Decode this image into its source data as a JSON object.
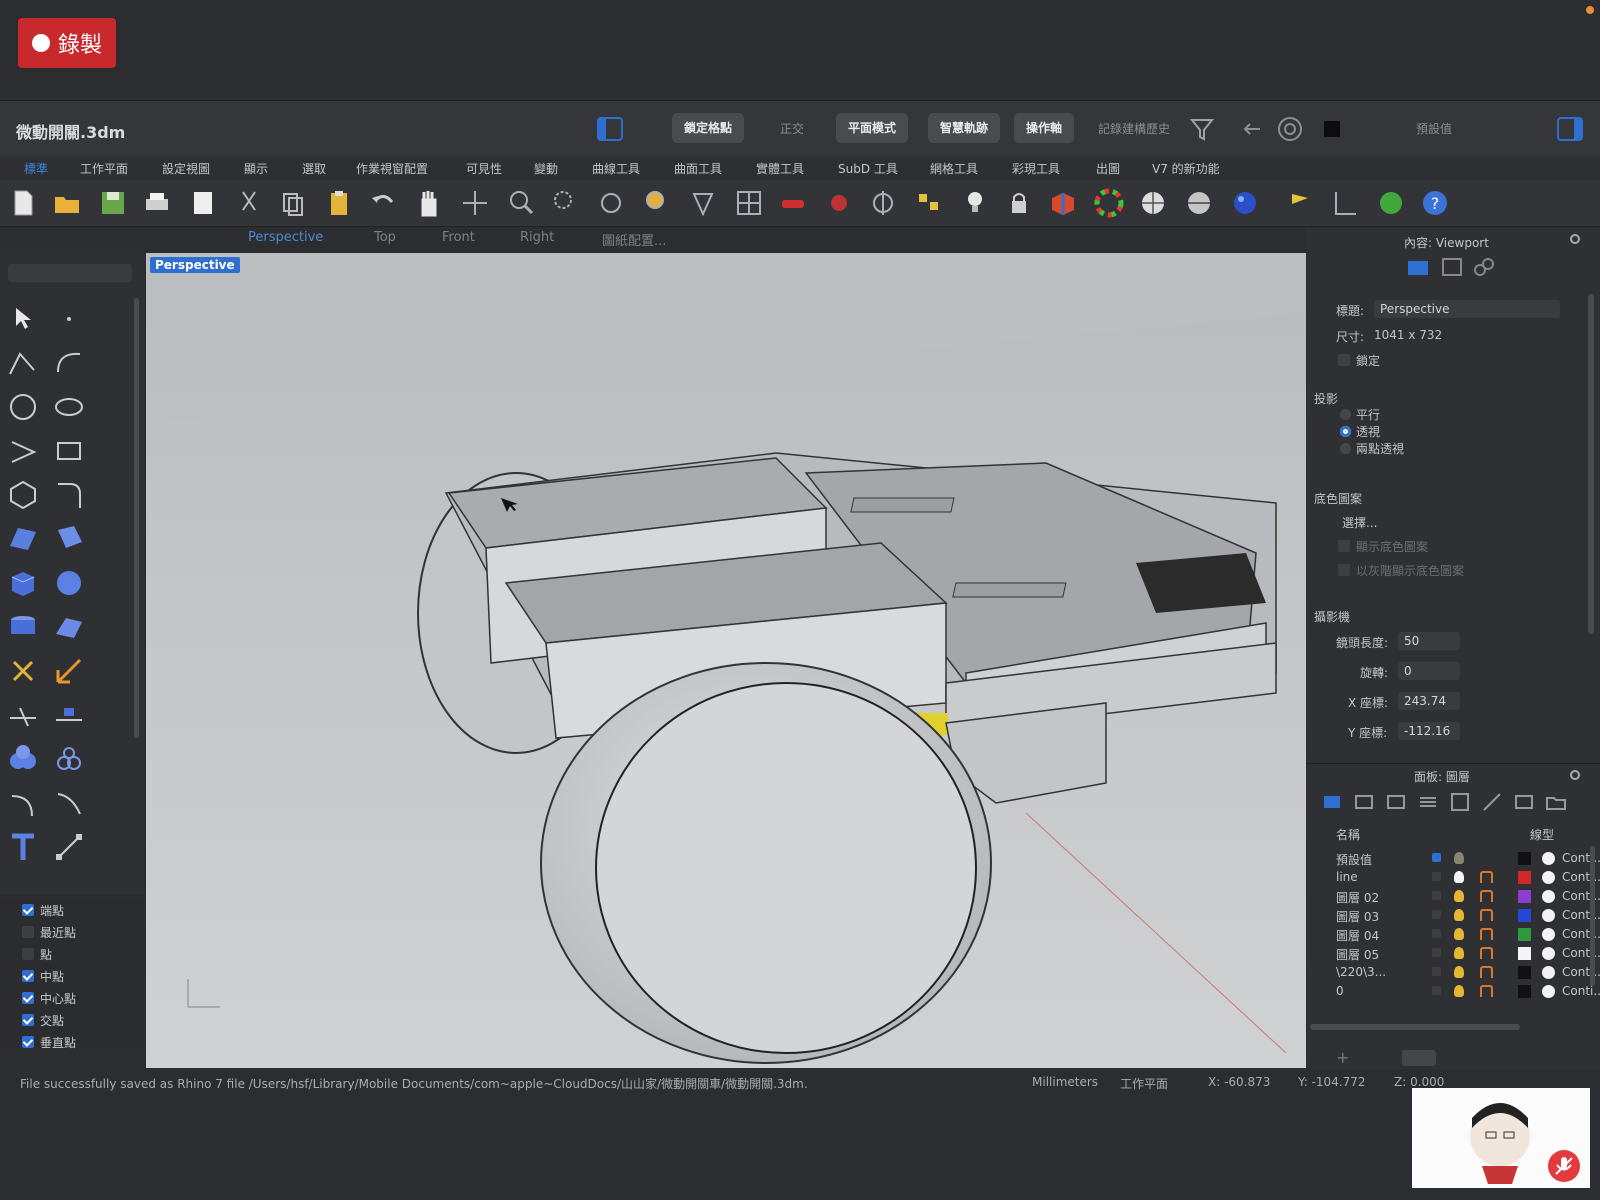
{
  "recording": {
    "label": "錄製"
  },
  "titlebar": {
    "doc_title": "微動開關.3dm",
    "buttons": [
      "鎖定格點",
      "正交",
      "平面模式",
      "智慧軌跡",
      "操作軸",
      "記錄建構歷史",
      "預設值"
    ]
  },
  "menu": {
    "tabs": [
      "標準",
      "工作平面",
      "設定視圖",
      "顯示",
      "選取",
      "作業視窗配置",
      "可見性",
      "變動",
      "曲線工具",
      "曲面工具",
      "實體工具",
      "SubD 工具",
      "網格工具",
      "彩現工具",
      "出圖",
      "V7 的新功能"
    ],
    "active_index": 0
  },
  "view_tabs": {
    "tabs": [
      "Perspective",
      "Top",
      "Front",
      "Right",
      "圖紙配置..."
    ],
    "active_index": 0
  },
  "viewport": {
    "label": "Perspective"
  },
  "osnap": {
    "items": [
      {
        "label": "端點",
        "checked": true
      },
      {
        "label": "最近點",
        "checked": false
      },
      {
        "label": "點",
        "checked": false
      },
      {
        "label": "中點",
        "checked": true
      },
      {
        "label": "中心點",
        "checked": true
      },
      {
        "label": "交點",
        "checked": true
      },
      {
        "label": "垂直點",
        "checked": true
      }
    ]
  },
  "properties": {
    "header": "內容: Viewport",
    "title_label": "標題:",
    "title_value": "Perspective",
    "size_label": "尺寸:",
    "size_value": "1041 x 732",
    "lock_label": "鎖定",
    "projection_heading": "投影",
    "projection_options": [
      "平行",
      "透視",
      "兩點透視"
    ],
    "projection_selected": 1,
    "background_heading": "底色圖案",
    "background_select_label": "選擇...",
    "background_show": "顯示底色圖案",
    "background_gray": "以灰階顯示底色圖案",
    "camera_heading": "攝影機",
    "lens_label": "鏡頭長度:",
    "lens_value": "50",
    "rotation_label": "旋轉:",
    "rotation_value": "0",
    "x_label": "X 座標:",
    "x_value": "243.74",
    "y_label": "Y 座標:",
    "y_value": "-112.16"
  },
  "layers": {
    "header": "面板: 圖層",
    "col_name": "名稱",
    "col_linetype": "線型",
    "rows": [
      {
        "name": "預設值",
        "color": "#111111",
        "linetype": "Conti..."
      },
      {
        "name": "line",
        "color": "#d1262a",
        "linetype": "Conti..."
      },
      {
        "name": "圖層 02",
        "color": "#8a3fd1",
        "linetype": "Conti..."
      },
      {
        "name": "圖層 03",
        "color": "#2548d6",
        "linetype": "Conti..."
      },
      {
        "name": "圖層 04",
        "color": "#2d9a3c",
        "linetype": "Conti..."
      },
      {
        "name": "圖層 05",
        "color": "#f5f5f5",
        "linetype": "Conti..."
      },
      {
        "name": "\\220\\3...",
        "color": "#111111",
        "linetype": "Conti..."
      },
      {
        "name": "0",
        "color": "#111111",
        "linetype": "Conti..."
      }
    ]
  },
  "status": {
    "message": "File successfully saved as Rhino 7 file /Users/hsf/Library/Mobile Documents/com~apple~CloudDocs/山山家/微動開關車/微動開關.3dm.",
    "units": "Millimeters",
    "cplane": "工作平面",
    "x": "X: -60.873",
    "y": "Y: -104.772",
    "z": "Z: 0.000"
  },
  "colors": {
    "record": "#c8292c",
    "accent": "#2f6fd2",
    "active_tab": "#3a86d8"
  }
}
